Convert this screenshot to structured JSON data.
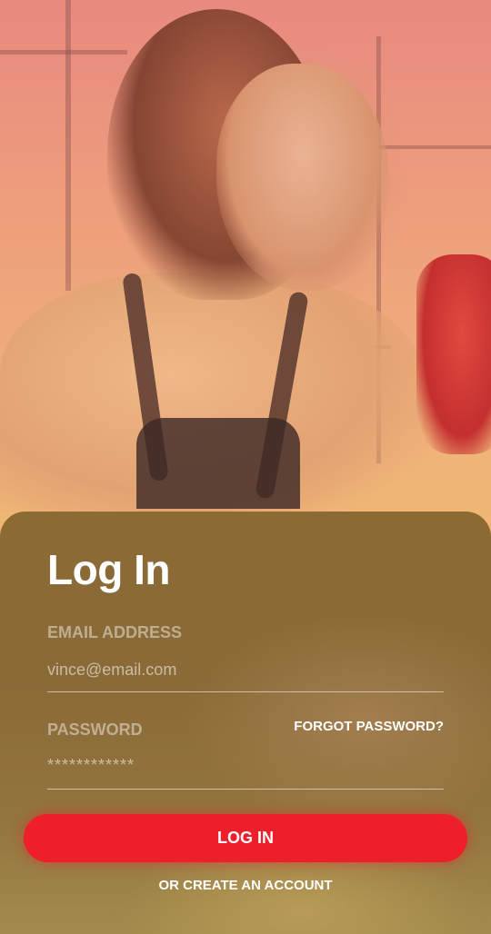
{
  "hero": {
    "image": "woman-boxer-photo",
    "overlay_colors": [
      "#e9897f",
      "#f0b17a"
    ]
  },
  "login": {
    "title": "Log In",
    "email": {
      "label": "EMAIL ADDRESS",
      "placeholder": "vince@email.com"
    },
    "password": {
      "label": "PASSWORD",
      "placeholder": "************"
    },
    "forgot_password": "FORGOT PASSWORD?",
    "submit_label": "LOG IN",
    "create_account": "OR CREATE AN ACCOUNT"
  },
  "colors": {
    "accent": "#ee1e2a",
    "card": "#8b6a34"
  }
}
